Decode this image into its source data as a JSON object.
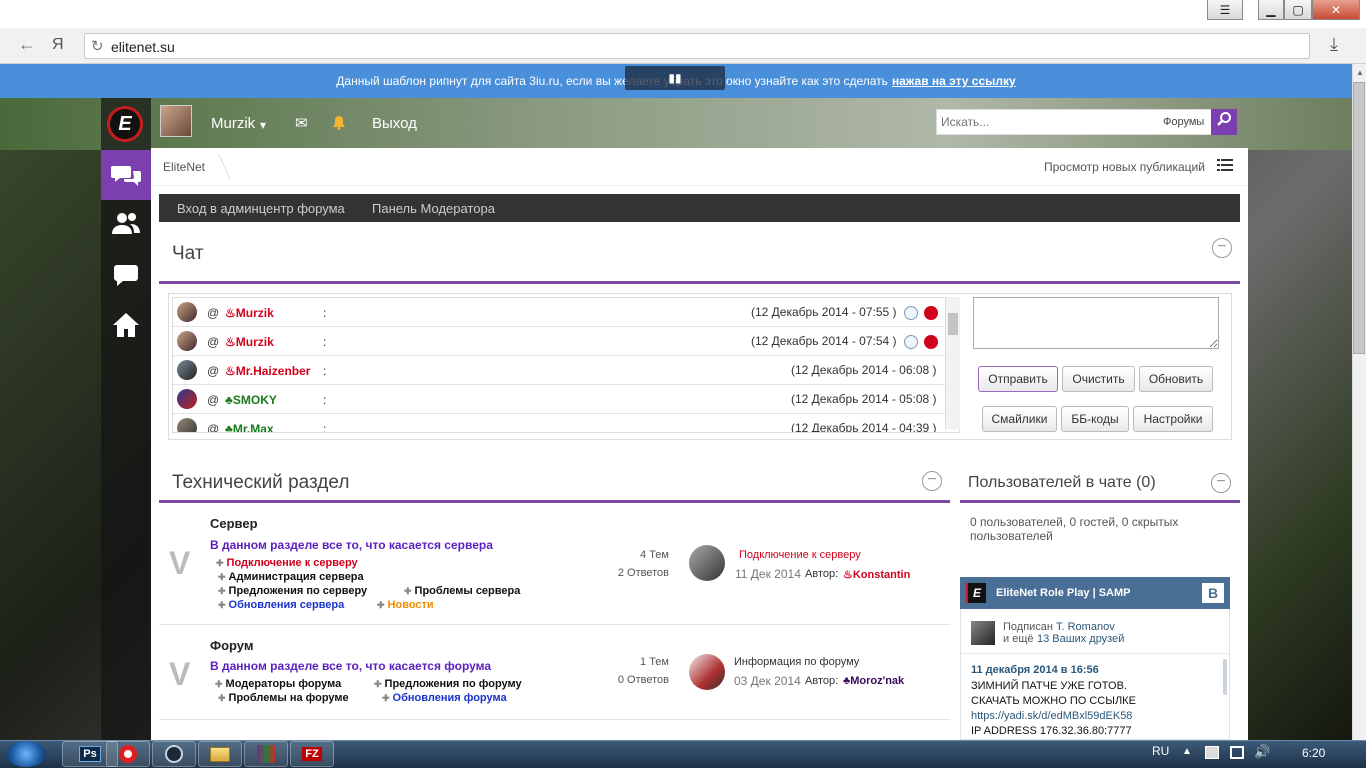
{
  "browser": {
    "url": "elitenet.su",
    "nav_back": "←",
    "brand_icon": "Я",
    "reload": "↻",
    "bookmark": "★",
    "download": "⤓"
  },
  "notice": {
    "text": "Данный шаблон рипнут для сайта 3iu.ru, если вы желаете убрать это окно узнайте как это сделать",
    "link": "нажав на эту ссылку"
  },
  "topbar": {
    "username": "Murzik",
    "caret": "▾",
    "mail_icon": "✉",
    "bell_icon": "🔔",
    "logout": "Выход",
    "search_placeholder": "Искать...",
    "search_scope": "Форумы"
  },
  "logo_letter": "E",
  "breadcrumb": {
    "home": "EliteNet",
    "new_posts": "Просмотр новых публикаций"
  },
  "modbar": {
    "admin": "Вход в админцентр форума",
    "moderator": "Панель Модератора"
  },
  "chat": {
    "title": "Чат",
    "collapse": "−",
    "rows": [
      {
        "at": "@",
        "user": "♨Murzik",
        "color": "#d0021b",
        "colon": ":",
        "time": "(12 Декабрь 2014 - 07:55 )"
      },
      {
        "at": "@",
        "user": "♨Murzik",
        "color": "#d0021b",
        "colon": ":",
        "time": "(12 Декабрь 2014 - 07:54 )"
      },
      {
        "at": "@",
        "user": "♨Mr.Haizenber",
        "color": "#d0021b",
        "colon": ":",
        "time": "(12 Декабрь 2014 - 06:08 )"
      },
      {
        "at": "@",
        "user": "♣SMOKY",
        "color": "#1a7a1a",
        "colon": ":",
        "time": "(12 Декабрь 2014 - 05:08 )"
      },
      {
        "at": "@",
        "user": "♣Mr.Max",
        "color": "#1a7a1a",
        "colon": ":",
        "time": "(12 Декабрь 2014 - 04:39 )"
      }
    ],
    "buttons": {
      "send": "Отправить",
      "clear": "Очистить",
      "refresh": "Обновить",
      "smileys": "Смайлики",
      "bbcodes": "ББ-коды",
      "settings": "Настройки"
    }
  },
  "tech": {
    "title": "Технический раздел",
    "collapse": "−",
    "forums": [
      {
        "name": "Сервер",
        "desc": "В данном разделе все то, что касается сервера",
        "subs": [
          {
            "label": "Подключение к серверу",
            "color": "#d0021b"
          },
          {
            "label": "Администрация сервера",
            "color": "#111111"
          },
          {
            "label": "Предложения по серверу",
            "color": "#111111"
          },
          {
            "label": "Проблемы сервера",
            "color": "#111111"
          },
          {
            "label": "Обновления сервера",
            "color": "#1a33cc"
          },
          {
            "label": "Новости",
            "color": "#f08c00"
          }
        ],
        "topics": "4 Тем",
        "replies": "2 Ответов",
        "last_title": "Подключение к серверу",
        "last_date": "11 Дек 2014",
        "author_label": "Автор:",
        "last_author": "♨Konstantin",
        "author_color": "#d0021b"
      },
      {
        "name": "Форум",
        "desc": "В данном разделе все то, что касается форума",
        "subs": [
          {
            "label": "Модераторы форума",
            "color": "#111111"
          },
          {
            "label": "Предложения по форуму",
            "color": "#111111"
          },
          {
            "label": "Проблемы на форуме",
            "color": "#111111"
          },
          {
            "label": "Обновления форума",
            "color": "#1a33cc"
          }
        ],
        "topics": "1 Тем",
        "replies": "0 Ответов",
        "last_title": "Информация по форуму",
        "last_date": "03 Дек 2014",
        "author_label": "Автор:",
        "last_author": "♣Moroz'nak",
        "author_color": "#3a0a5c"
      }
    ]
  },
  "chat_users": {
    "title": "Пользователей в чате (0)",
    "collapse": "−",
    "text": "0 пользователей, 0 гостей, 0 скрытых пользователей"
  },
  "vk": {
    "group": "EliteNet Role Play | SAMP",
    "badge": "B",
    "sub1": "Подписан",
    "sub1_name": "T. Romanov",
    "sub2": "и ещё",
    "sub2_link": "13 Ваших друзей",
    "post_date": "11 декабря 2014 в 16:56",
    "post_line1": "ЗИМНИЙ ПАТЧЕ УЖЕ ГОТОВ.",
    "post_line2": "СКАЧАТЬ МОЖНО ПО ССЫЛКЕ",
    "post_link": "https://yadi.sk/d/edMBxl59dEK58",
    "post_ip": "IP ADDRESS 176.32.36.80:7777"
  },
  "taskbar": {
    "lang": "RU",
    "time": "6:20",
    "ps": "Ps",
    "fz": "FZ"
  },
  "colors": {
    "accent": "#7b4aa0",
    "notice": "#4a8fd9",
    "vk": "#4a6f96"
  }
}
